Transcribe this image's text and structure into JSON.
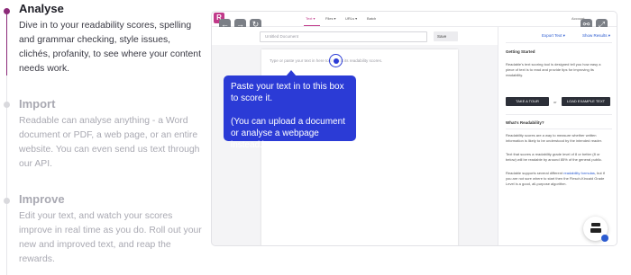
{
  "steps": [
    {
      "title": "Analyse",
      "body": "Dive in to your readability scores, spelling and grammar checking, style issues, clichés, profanity, to see where your content needs work."
    },
    {
      "title": "Import",
      "body": "Readable can analyse anything - a Word document or PDF, a web page, or an entire website. You can even send us text through our API."
    },
    {
      "title": "Improve",
      "body": "Edit your text, and watch your scores improve in real time as you do. Roll out your new and improved text, and reap the rewards."
    }
  ],
  "app": {
    "brand": "R",
    "nav": [
      "Text ▾",
      "Files ▾",
      "URLs ▾",
      "Batch"
    ],
    "account": "Account",
    "doc_title": "Untitled Document",
    "save": "Save",
    "export": "Export Text ▾",
    "show_results": "Show Results ▾",
    "editor_placeholder": "Type or paste your text in here to find out its readability scores.",
    "sidebar": {
      "getting_started": "Getting Started",
      "gs_text": "Readable's text scoring tool is designed tell you how easy a piece of text is to read and provide tips for improving its readability.",
      "tour": "TAKE A TOUR",
      "or": "or",
      "load_example": "LOAD EXAMPLE TEXT",
      "what_title": "What's Readability?",
      "what_p1": "Readability scores are a way to measure whether written information is likely to be understood by the intended reader.",
      "what_p2": "Text that scores a readability grade level of 8 or better (8 or below) will be readable by around 85% of the general public.",
      "what_p3_a": "Readable supports several different ",
      "what_p3_link": "readability formulas",
      "what_p3_b": ", but if you are not sure where to start then the Flesch-Kincaid Grade Level is a good, all-purpose algorithm."
    }
  },
  "tooltip": {
    "line1": "Paste your text in to this box to score it.",
    "line2": "(You can upload a document or analyse a webpage instead.)"
  },
  "colors": {
    "accent": "#8c2b79",
    "tooltip": "#2b3bd6",
    "brand": "#c13a8a"
  }
}
